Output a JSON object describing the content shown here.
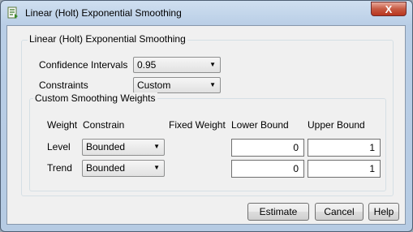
{
  "window": {
    "title": "Linear (Holt) Exponential Smoothing",
    "close_label": "X"
  },
  "group": {
    "title": "Linear (Holt) Exponential Smoothing"
  },
  "confidence": {
    "label": "Confidence Intervals",
    "value": "0.95"
  },
  "constraints": {
    "label": "Constraints",
    "value": "Custom"
  },
  "weights": {
    "title": "Custom Smoothing Weights",
    "headers": {
      "weight": "Weight",
      "constrain": "Constrain",
      "fixed": "Fixed Weight",
      "lower": "Lower Bound",
      "upper": "Upper Bound"
    },
    "rows": [
      {
        "name": "Level",
        "constrain": "Bounded",
        "lower": "0",
        "upper": "1"
      },
      {
        "name": "Trend",
        "constrain": "Bounded",
        "lower": "0",
        "upper": "1"
      }
    ]
  },
  "buttons": {
    "estimate": "Estimate",
    "cancel": "Cancel",
    "help": "Help"
  }
}
